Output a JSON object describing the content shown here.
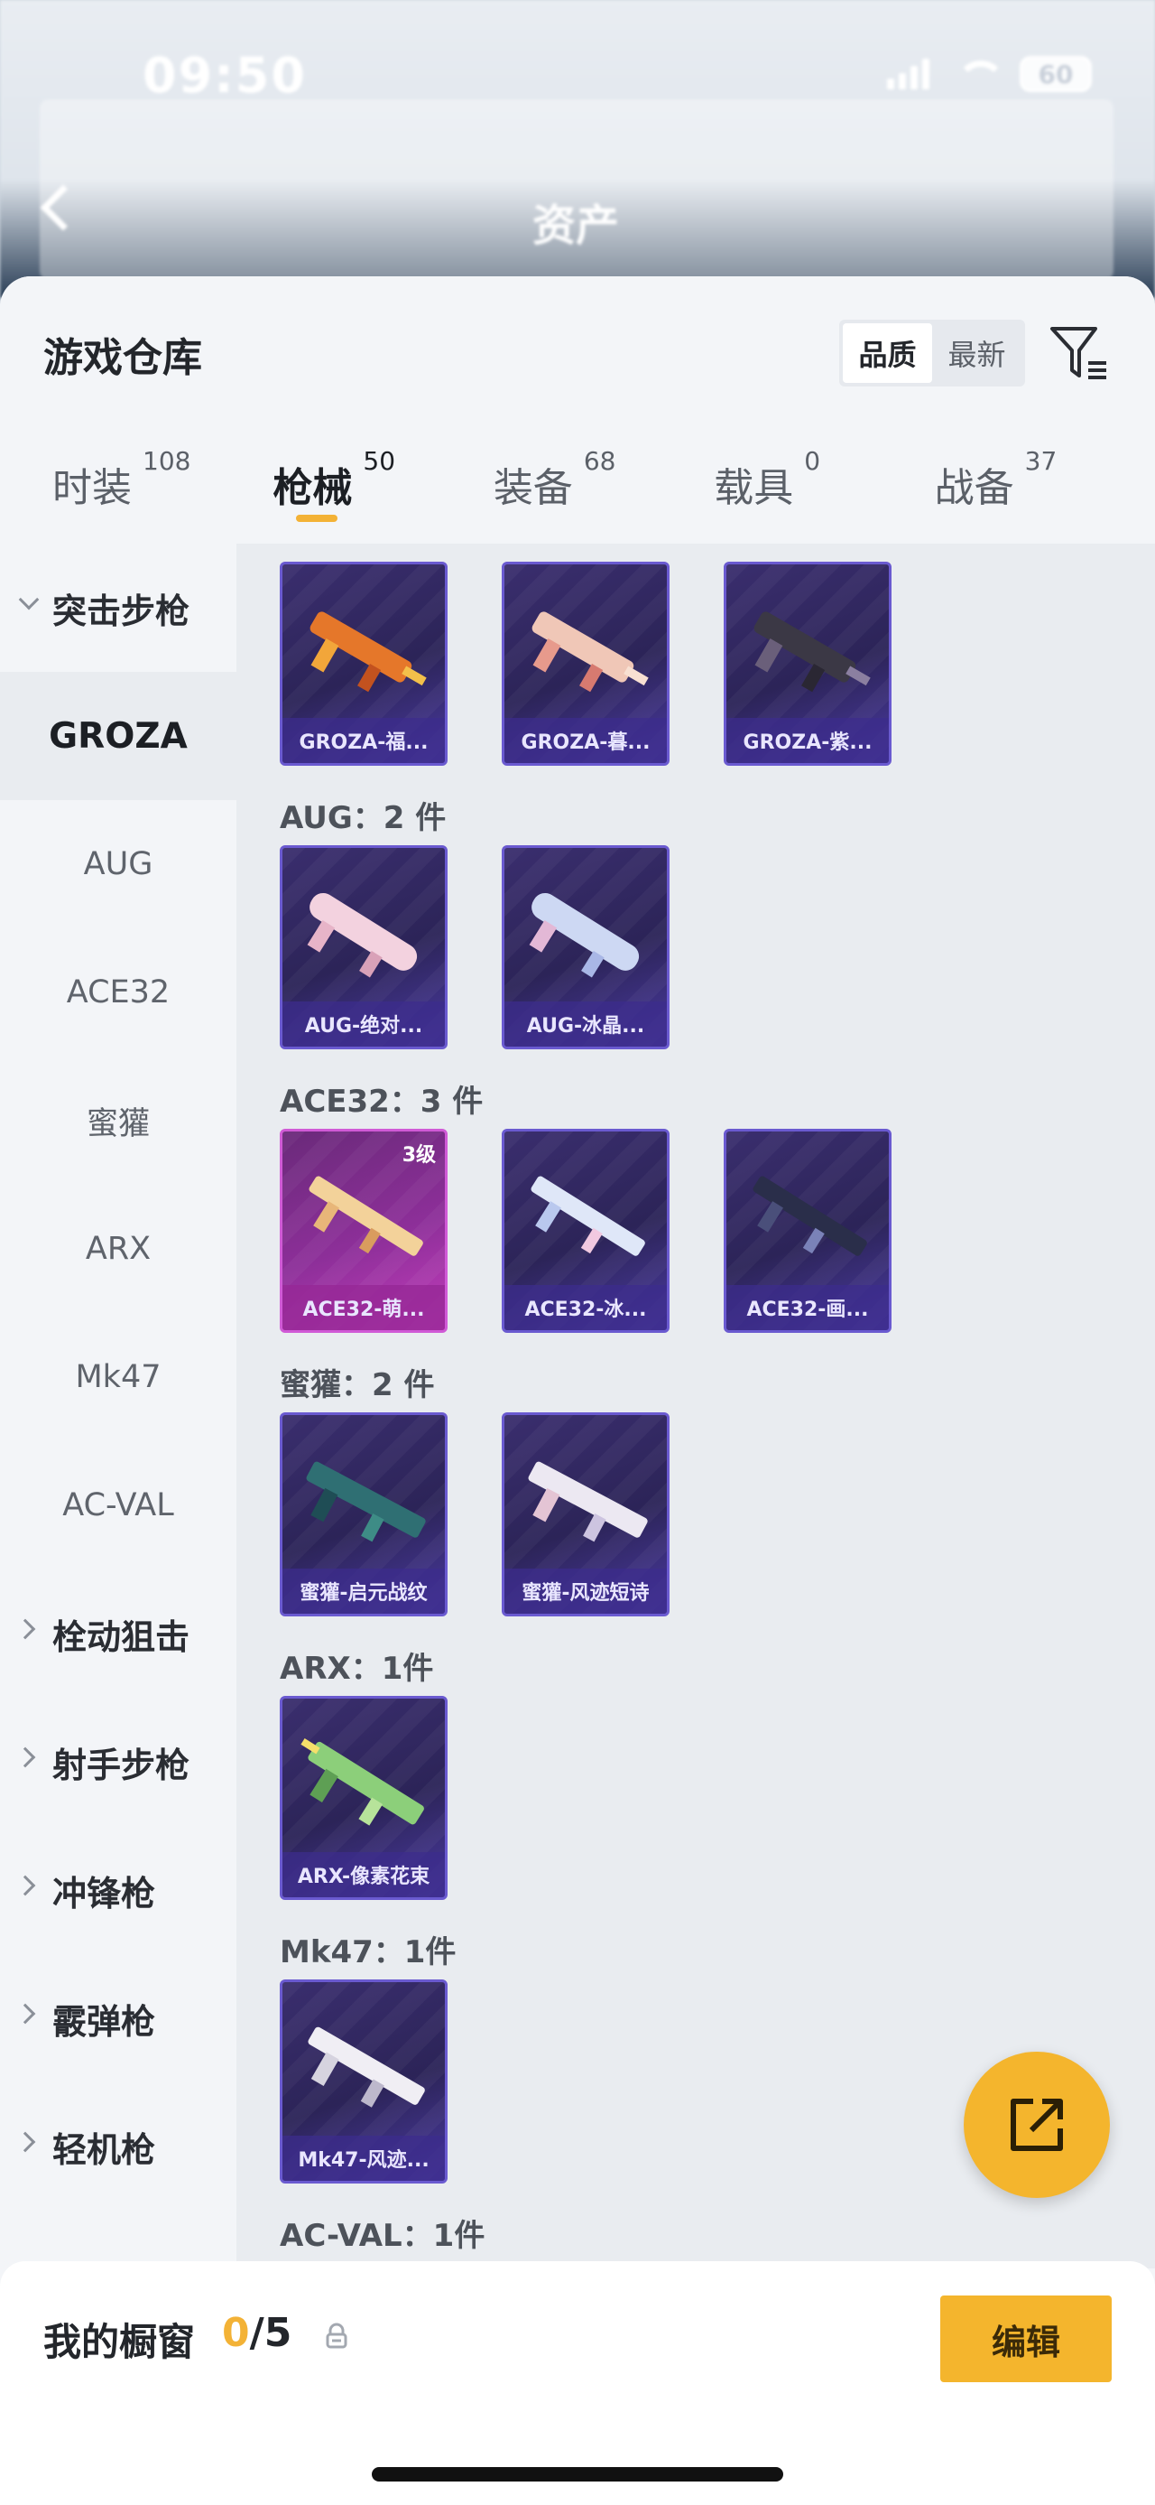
{
  "status_bar": {
    "time": "09:50",
    "battery": "60"
  },
  "nav": {
    "title": "资产"
  },
  "sheet": {
    "title": "游戏仓库",
    "sort_options": [
      "品质",
      "最新"
    ],
    "sort_active": "品质",
    "tabs": [
      {
        "label": "时装",
        "count": "108"
      },
      {
        "label": "枪械",
        "count": "50"
      },
      {
        "label": "装备",
        "count": "68"
      },
      {
        "label": "载具",
        "count": "0"
      },
      {
        "label": "战备",
        "count": "37"
      }
    ]
  },
  "sidebar": {
    "category_assault": "突击步枪",
    "subs": [
      "GROZA",
      "AUG",
      "ACE32",
      "蜜獾",
      "ARX",
      "Mk47",
      "AC-VAL"
    ],
    "categories": [
      "栓动狙击",
      "射手步枪",
      "冲锋枪",
      "霰弹枪",
      "轻机枪"
    ]
  },
  "groups": {
    "aug": "AUG：2 件",
    "ace32": "ACE32：3 件",
    "honeybadger": "蜜獾：2 件",
    "arx": "ARX：1件",
    "mk47": "Mk47：1件",
    "acval": "AC-VAL：1件"
  },
  "cards": {
    "groza1": "GROZA-福...",
    "groza2": "GROZA-暮...",
    "groza3": "GROZA-紫...",
    "aug1": "AUG-绝对...",
    "aug2": "AUG-冰晶...",
    "ace1": "ACE32-萌...",
    "ace1_level": "3级",
    "ace2": "ACE32-冰...",
    "ace3": "ACE32-画...",
    "hb1": "蜜獾-启元战纹",
    "hb2": "蜜獾-风迹短诗",
    "arx1": "ARX-像素花束",
    "mk1": "Mk47-风迹..."
  },
  "bottom": {
    "title": "我的橱窗",
    "current": "0",
    "total": "/5",
    "edit": "编辑"
  },
  "colors": {
    "accent": "#f4b52d",
    "card_purple": "#2c2458",
    "card_pink": "#8d2f99"
  }
}
